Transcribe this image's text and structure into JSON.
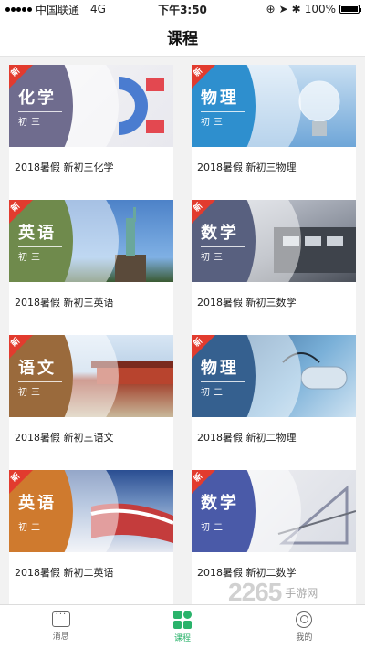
{
  "status": {
    "carrier": "中国联通",
    "network": "4G",
    "time": "下午3:50",
    "battery": "100%",
    "battery_level": 1.0
  },
  "header": {
    "title": "课程"
  },
  "new_badge": "新",
  "courses": [
    {
      "subject": "化学",
      "grade": "初三",
      "title": "2018暑假 新初三化学",
      "tag_color": "#6f6c8e",
      "scene": "magnet"
    },
    {
      "subject": "物理",
      "grade": "初三",
      "title": "2018暑假 新初三物理",
      "tag_color": "#2e8fce",
      "scene": "bulb"
    },
    {
      "subject": "英语",
      "grade": "初三",
      "title": "2018暑假 新初三英语",
      "tag_color": "#6f8a4c",
      "scene": "liberty"
    },
    {
      "subject": "数学",
      "grade": "初三",
      "title": "2018暑假 新初三数学",
      "tag_color": "#58607f",
      "scene": "calculator"
    },
    {
      "subject": "语文",
      "grade": "初三",
      "title": "2018暑假 新初三语文",
      "tag_color": "#9a6a3c",
      "scene": "palace"
    },
    {
      "subject": "物理",
      "grade": "初二",
      "title": "2018暑假 新初二物理",
      "tag_color": "#35608f",
      "scene": "battery"
    },
    {
      "subject": "英语",
      "grade": "初二",
      "title": "2018暑假 新初二英语",
      "tag_color": "#cf7a2e",
      "scene": "flag"
    },
    {
      "subject": "数学",
      "grade": "初二",
      "title": "2018暑假 新初二数学",
      "tag_color": "#4a5aa8",
      "scene": "ruler"
    }
  ],
  "tabs": [
    {
      "label": "消息",
      "icon": "message-icon",
      "active": false
    },
    {
      "label": "课程",
      "icon": "course-icon",
      "active": true
    },
    {
      "label": "我的",
      "icon": "profile-icon",
      "active": false
    }
  ],
  "watermark": {
    "number": "2265",
    "text": "手游网"
  },
  "colors": {
    "accent": "#2ab36b",
    "badge": "#e23b2e"
  }
}
